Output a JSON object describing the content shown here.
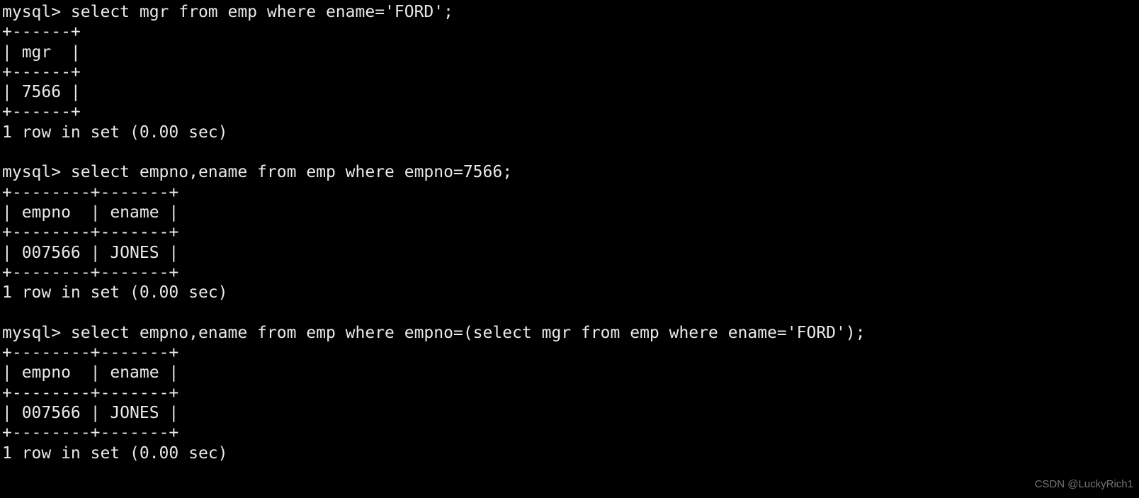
{
  "terminal": {
    "prompt": "mysql>",
    "background_color": "#000000",
    "text_color": "#e9e9e9",
    "lines": [
      "mysql> select mgr from emp where ename='FORD';",
      "+------+",
      "| mgr  |",
      "+------+",
      "| 7566 |",
      "+------+",
      "1 row in set (0.00 sec)",
      "",
      "mysql> select empno,ename from emp where empno=7566;",
      "+--------+-------+",
      "| empno  | ename |",
      "+--------+-------+",
      "| 007566 | JONES |",
      "+--------+-------+",
      "1 row in set (0.00 sec)",
      "",
      "mysql> select empno,ename from emp where empno=(select mgr from emp where ename='FORD');",
      "+--------+-------+",
      "| empno  | ename |",
      "+--------+-------+",
      "| 007566 | JONES |",
      "+--------+-------+",
      "1 row in set (0.00 sec)"
    ],
    "queries": [
      "select mgr from emp where ename='FORD';",
      "select empno,ename from emp where empno=7566;",
      "select empno,ename from emp where empno=(select mgr from emp where ename='FORD');"
    ],
    "results": [
      {
        "columns": [
          "mgr"
        ],
        "rows": [
          [
            "7566"
          ]
        ],
        "status": "1 row in set (0.00 sec)"
      },
      {
        "columns": [
          "empno",
          "ename"
        ],
        "rows": [
          [
            "007566",
            "JONES"
          ]
        ],
        "status": "1 row in set (0.00 sec)"
      },
      {
        "columns": [
          "empno",
          "ename"
        ],
        "rows": [
          [
            "007566",
            "JONES"
          ]
        ],
        "status": "1 row in set (0.00 sec)"
      }
    ]
  },
  "watermark": {
    "text": "CSDN @LuckyRich1",
    "color": "#8a8a8a"
  }
}
